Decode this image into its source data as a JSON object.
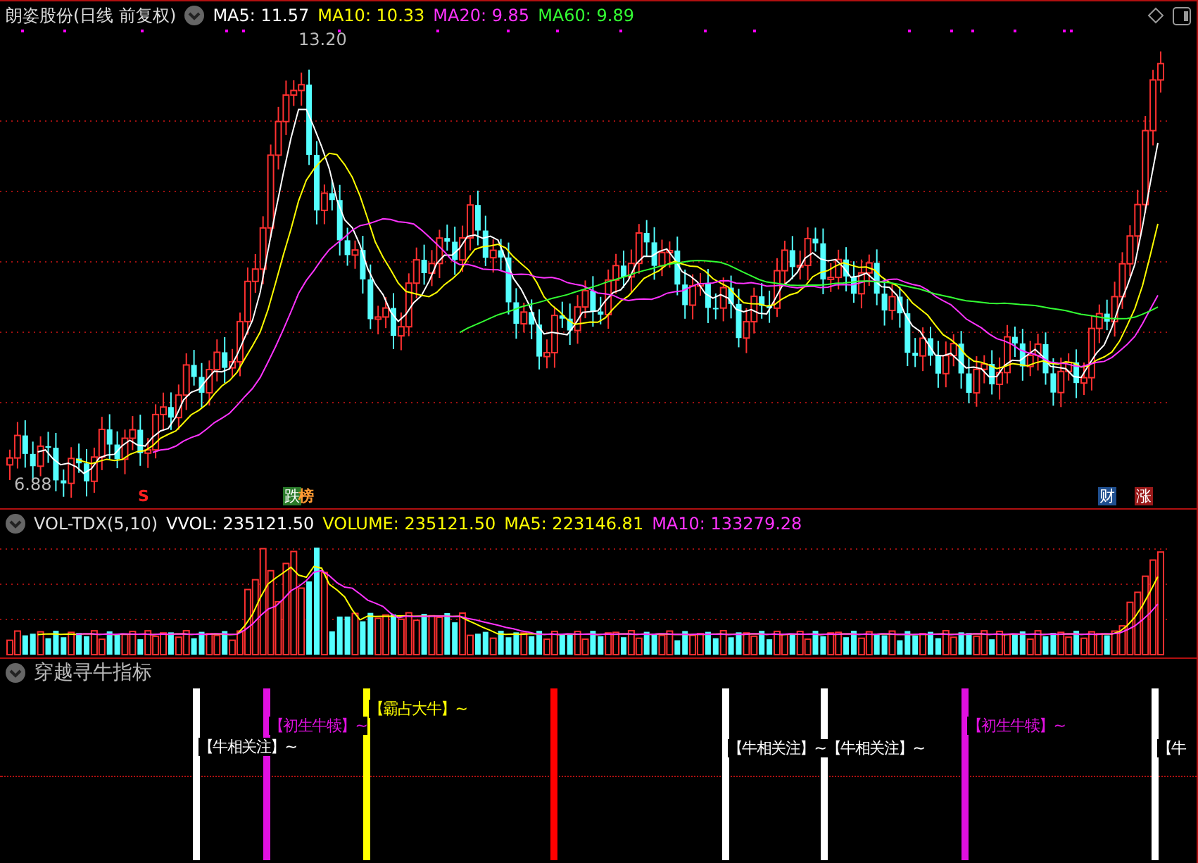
{
  "main_panel": {
    "title": "朗姿股份(日线 前复权)",
    "indicators": [
      {
        "label": "MA5: 11.57",
        "color": "#ffffff"
      },
      {
        "label": "MA10: 10.33",
        "color": "#ffff00"
      },
      {
        "label": "MA20: 9.85",
        "color": "#ff33ff"
      },
      {
        "label": "MA60: 9.89",
        "color": "#33ff33"
      }
    ],
    "high_label": "13.20",
    "low_label": "6.88",
    "markers": [
      {
        "label": "S",
        "kind": "plain",
        "color": "#ff2020"
      },
      {
        "label": "跌",
        "kind": "boxed",
        "color": "#2a7a2a"
      },
      {
        "label": "榜",
        "kind": "plain",
        "color": "#ff9933"
      },
      {
        "label": "财",
        "kind": "boxed",
        "color": "#1f4f8f"
      },
      {
        "label": "涨",
        "kind": "boxed",
        "color": "#9a1a1a"
      }
    ]
  },
  "volume_panel": {
    "title": "VOL-TDX(5,10)",
    "indicators": [
      {
        "label": "VVOL: 235121.50",
        "color": "#ffffff"
      },
      {
        "label": "VOLUME: 235121.50",
        "color": "#ffff00"
      },
      {
        "label": "MA5: 223146.81",
        "color": "#ffff00"
      },
      {
        "label": "MA10: 133279.28",
        "color": "#ff33ff"
      }
    ]
  },
  "signal_panel": {
    "title": "穿越寻牛指标",
    "signals": [
      {
        "label": "【牛相关注】~",
        "color": "#ffffff"
      },
      {
        "label": "【初生牛犊】~",
        "color": "#e010e0"
      },
      {
        "label": "【霸占大牛】~",
        "color": "#ffff00"
      },
      {
        "color": "#ff0000"
      },
      {
        "label": "【牛相关注】~",
        "color": "#ffffff"
      },
      {
        "label": "【牛相关注】~",
        "color": "#ffffff"
      },
      {
        "label": "【初生牛犊】~",
        "color": "#e010e0"
      },
      {
        "label": "【牛",
        "color": "#ffffff"
      }
    ]
  }
}
